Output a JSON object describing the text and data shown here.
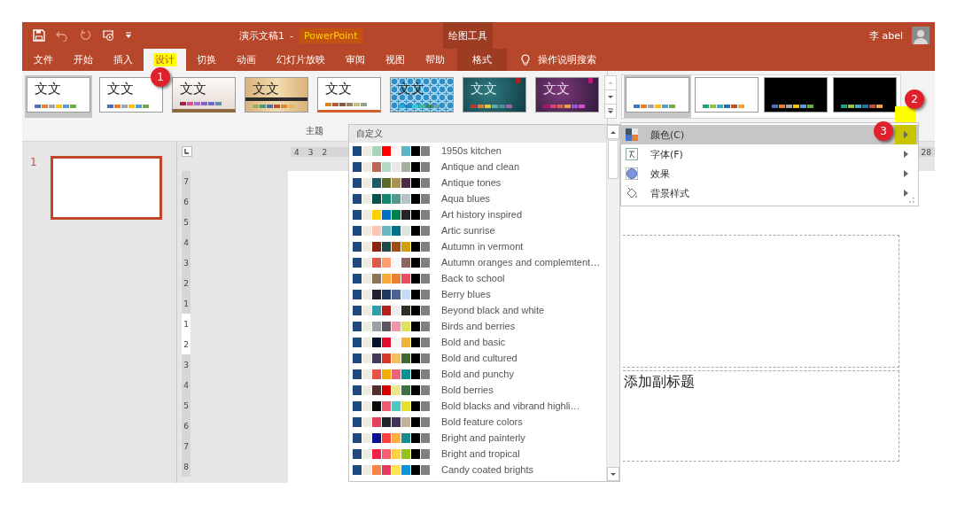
{
  "title_bar": {
    "document_title": "演示文稿1",
    "separator": "-",
    "app_name": "PowerPoint",
    "context_group": "绘图工具",
    "user_name": "李 abel"
  },
  "tabs": [
    {
      "label": "文件",
      "selected": false,
      "highlighted": false,
      "kind": "normal"
    },
    {
      "label": "开始",
      "selected": false,
      "highlighted": false,
      "kind": "normal"
    },
    {
      "label": "插入",
      "selected": false,
      "highlighted": false,
      "kind": "normal"
    },
    {
      "label": "设计",
      "selected": true,
      "highlighted": true,
      "kind": "normal"
    },
    {
      "label": "切换",
      "selected": false,
      "highlighted": false,
      "kind": "normal"
    },
    {
      "label": "动画",
      "selected": false,
      "highlighted": false,
      "kind": "normal"
    },
    {
      "label": "幻灯片放映",
      "selected": false,
      "highlighted": false,
      "kind": "normal"
    },
    {
      "label": "审阅",
      "selected": false,
      "highlighted": false,
      "kind": "normal"
    },
    {
      "label": "视图",
      "selected": false,
      "highlighted": false,
      "kind": "normal"
    },
    {
      "label": "帮助",
      "selected": false,
      "highlighted": false,
      "kind": "normal"
    },
    {
      "label": "格式",
      "selected": false,
      "highlighted": false,
      "kind": "context"
    }
  ],
  "tell_me": "操作说明搜索",
  "themes": {
    "label": "主题",
    "items": [
      {
        "kind": "plain",
        "sample": "文文",
        "selected": true,
        "swatches": [
          {
            "color": "#4472c4"
          },
          {
            "color": "#ed7d31"
          },
          {
            "color": "#a5a5a5"
          },
          {
            "color": "#ffc000"
          },
          {
            "color": "#5b9bd5"
          },
          {
            "color": "#70ad47"
          }
        ]
      },
      {
        "kind": "plain",
        "sample": "文文",
        "selected": false,
        "swatches": [
          {
            "color": "#4472c4"
          },
          {
            "color": "#ed7d31"
          },
          {
            "color": "#a5a5a5"
          },
          {
            "color": "#ffc000"
          },
          {
            "color": "#5b9bd5"
          },
          {
            "color": "#70ad47"
          }
        ]
      },
      {
        "kind": "paper",
        "sample": "文文",
        "selected": false,
        "swatches": [
          {
            "color": "#a5214e"
          },
          {
            "color": "#e44e8a"
          },
          {
            "color": "#b066e0"
          },
          {
            "color": "#8a5fd0"
          },
          {
            "color": "#6a6ae0"
          },
          {
            "color": "#5b8ea8"
          }
        ]
      },
      {
        "kind": "wood",
        "sample": "文文",
        "selected": false,
        "swatches": [
          {
            "color": "#94b264"
          },
          {
            "color": "#3d9e8c"
          },
          {
            "color": "#4a72ad"
          },
          {
            "color": "#c04f3a"
          },
          {
            "color": "#e08a30"
          },
          {
            "color": "#e8b84a"
          }
        ]
      },
      {
        "kind": "rule",
        "sample": "文文",
        "selected": false,
        "swatches": [
          {
            "color": "#e48312"
          },
          {
            "color": "#bd582c"
          },
          {
            "color": "#865640"
          },
          {
            "color": "#9b8357"
          },
          {
            "color": "#c2bc80"
          },
          {
            "color": "#94a088"
          }
        ]
      },
      {
        "kind": "pattern",
        "sample": "文文",
        "selected": false,
        "swatches": [
          {
            "color": "#1cade4"
          },
          {
            "color": "#2683c6"
          },
          {
            "color": "#27ced7"
          },
          {
            "color": "#42ba97"
          },
          {
            "color": "#3e8853"
          },
          {
            "color": "#62a39f"
          }
        ]
      },
      {
        "kind": "teal",
        "sample": "文文",
        "selected": false,
        "swatches": [
          {
            "color": "#c0392b"
          },
          {
            "color": "#e87a2a"
          },
          {
            "color": "#f2c12e"
          },
          {
            "color": "#5bb38f"
          },
          {
            "color": "#4e8aa8"
          },
          {
            "color": "#a85fa8"
          }
        ]
      },
      {
        "kind": "purple",
        "sample": "文文",
        "selected": false,
        "swatches": [
          {
            "color": "#b31166"
          },
          {
            "color": "#e33d6f"
          },
          {
            "color": "#e45f3c"
          },
          {
            "color": "#e9a23b"
          },
          {
            "color": "#9b57d3"
          },
          {
            "color": "#d24fd4"
          }
        ]
      }
    ]
  },
  "variants": [
    {
      "kind": "light",
      "selected": true,
      "swatches": [
        {
          "color": "#4472c4"
        },
        {
          "color": "#ed7d31"
        },
        {
          "color": "#a5a5a5"
        },
        {
          "color": "#ffc000"
        },
        {
          "color": "#5b9bd5"
        },
        {
          "color": "#70ad47"
        }
      ]
    },
    {
      "kind": "light",
      "selected": false,
      "swatches": [
        {
          "color": "#1fa186"
        },
        {
          "color": "#8cc43f"
        },
        {
          "color": "#37aec9"
        },
        {
          "color": "#2271ae"
        },
        {
          "color": "#c2502d"
        },
        {
          "color": "#f4a02a"
        }
      ]
    },
    {
      "kind": "dark",
      "selected": false,
      "swatches": [
        {
          "color": "#4472c4"
        },
        {
          "color": "#ed7d31"
        },
        {
          "color": "#a5a5a5"
        },
        {
          "color": "#ffc000"
        },
        {
          "color": "#5b9bd5"
        },
        {
          "color": "#70ad47"
        }
      ]
    },
    {
      "kind": "dark",
      "selected": false,
      "swatches": [
        {
          "color": "#1fa186"
        },
        {
          "color": "#8cc43f"
        },
        {
          "color": "#37aec9"
        },
        {
          "color": "#2271ae"
        },
        {
          "color": "#c2502d"
        },
        {
          "color": "#f4a02a"
        }
      ]
    }
  ],
  "color_schemes": {
    "header": "自定义",
    "items": [
      {
        "name": "1950s kitchen",
        "swatches": [
          {
            "color": "#1f497d"
          },
          {
            "color": "#eeece1"
          },
          {
            "color": "#a8d5b8"
          },
          {
            "color": "#ff0000"
          },
          {
            "color": "#fdf5f5"
          },
          {
            "color": "#5bb5c9"
          },
          {
            "color": "#000000"
          },
          {
            "color": "#808080"
          }
        ]
      },
      {
        "name": "Antique and clean",
        "swatches": [
          {
            "color": "#1f497d"
          },
          {
            "color": "#eeece1"
          },
          {
            "color": "#b86655"
          },
          {
            "color": "#b3dbc0"
          },
          {
            "color": "#ece6ec"
          },
          {
            "color": "#a3b09e"
          },
          {
            "color": "#000000"
          },
          {
            "color": "#808080"
          }
        ]
      },
      {
        "name": "Antique tones",
        "swatches": [
          {
            "color": "#1f497d"
          },
          {
            "color": "#eeece1"
          },
          {
            "color": "#1c5c65"
          },
          {
            "color": "#5a6a2a"
          },
          {
            "color": "#aa9350"
          },
          {
            "color": "#4e2c3f"
          },
          {
            "color": "#000000"
          },
          {
            "color": "#808080"
          }
        ]
      },
      {
        "name": "Aqua blues",
        "swatches": [
          {
            "color": "#1f497d"
          },
          {
            "color": "#eeece1"
          },
          {
            "color": "#06524a"
          },
          {
            "color": "#168572"
          },
          {
            "color": "#549a8c"
          },
          {
            "color": "#b4c3c6"
          },
          {
            "color": "#000000"
          },
          {
            "color": "#808080"
          }
        ]
      },
      {
        "name": "Art history inspired",
        "swatches": [
          {
            "color": "#1f497d"
          },
          {
            "color": "#eeece1"
          },
          {
            "color": "#ffd000"
          },
          {
            "color": "#0070c0"
          },
          {
            "color": "#008050"
          },
          {
            "color": "#252228"
          },
          {
            "color": "#000000"
          },
          {
            "color": "#808080"
          }
        ]
      },
      {
        "name": "Artic sunrise",
        "swatches": [
          {
            "color": "#1f497d"
          },
          {
            "color": "#eeece1"
          },
          {
            "color": "#ffc4b4"
          },
          {
            "color": "#6ab5c2"
          },
          {
            "color": "#036f88"
          },
          {
            "color": "#dde5e0"
          },
          {
            "color": "#000000"
          },
          {
            "color": "#808080"
          }
        ]
      },
      {
        "name": "Autumn in vermont",
        "swatches": [
          {
            "color": "#1f497d"
          },
          {
            "color": "#eeece1"
          },
          {
            "color": "#8b2510"
          },
          {
            "color": "#1f4a4b"
          },
          {
            "color": "#9c4f0e"
          },
          {
            "color": "#cf9e0d"
          },
          {
            "color": "#000000"
          },
          {
            "color": "#808080"
          }
        ]
      },
      {
        "name": "Autumn oranges and complemtent…",
        "swatches": [
          {
            "color": "#1f497d"
          },
          {
            "color": "#eeece1"
          },
          {
            "color": "#dc5a48"
          },
          {
            "color": "#ff9e74"
          },
          {
            "color": "#f6f8fc"
          },
          {
            "color": "#8e6660"
          },
          {
            "color": "#000000"
          },
          {
            "color": "#808080"
          }
        ]
      },
      {
        "name": "Back to school",
        "swatches": [
          {
            "color": "#1f497d"
          },
          {
            "color": "#eeece1"
          },
          {
            "color": "#8c7458"
          },
          {
            "color": "#f8ab3a"
          },
          {
            "color": "#e8822e"
          },
          {
            "color": "#e5505f"
          },
          {
            "color": "#000000"
          },
          {
            "color": "#808080"
          }
        ]
      },
      {
        "name": "Berry blues",
        "swatches": [
          {
            "color": "#1f497d"
          },
          {
            "color": "#eeece1"
          },
          {
            "color": "#1f2032"
          },
          {
            "color": "#24385f"
          },
          {
            "color": "#4b6290"
          },
          {
            "color": "#c8dbf5"
          },
          {
            "color": "#000000"
          },
          {
            "color": "#808080"
          }
        ]
      },
      {
        "name": "Beyond black and white",
        "swatches": [
          {
            "color": "#1f497d"
          },
          {
            "color": "#eeece1"
          },
          {
            "color": "#30a0a8"
          },
          {
            "color": "#b3201e"
          },
          {
            "color": "#ededed"
          },
          {
            "color": "#2f2f28"
          },
          {
            "color": "#000000"
          },
          {
            "color": "#808080"
          }
        ]
      },
      {
        "name": "Birds and berries",
        "swatches": [
          {
            "color": "#1f497d"
          },
          {
            "color": "#eeece1"
          },
          {
            "color": "#9aa0a8"
          },
          {
            "color": "#5e5563"
          },
          {
            "color": "#ee96a5"
          },
          {
            "color": "#e2e060"
          },
          {
            "color": "#000000"
          },
          {
            "color": "#808080"
          }
        ]
      },
      {
        "name": "Bold and basic",
        "swatches": [
          {
            "color": "#1f497d"
          },
          {
            "color": "#eeece1"
          },
          {
            "color": "#07122e"
          },
          {
            "color": "#df0d2e"
          },
          {
            "color": "#f8f5f0"
          },
          {
            "color": "#f0b43c"
          },
          {
            "color": "#000000"
          },
          {
            "color": "#808080"
          }
        ]
      },
      {
        "name": "Bold and cultured",
        "swatches": [
          {
            "color": "#1f497d"
          },
          {
            "color": "#eeece1"
          },
          {
            "color": "#45385b"
          },
          {
            "color": "#d33a2c"
          },
          {
            "color": "#f2bf5a"
          },
          {
            "color": "#44662e"
          },
          {
            "color": "#000000"
          },
          {
            "color": "#808080"
          }
        ]
      },
      {
        "name": "Bold and punchy",
        "swatches": [
          {
            "color": "#1f497d"
          },
          {
            "color": "#eeece1"
          },
          {
            "color": "#e65045"
          },
          {
            "color": "#f0ae00"
          },
          {
            "color": "#eb6378"
          },
          {
            "color": "#0b9090"
          },
          {
            "color": "#000000"
          },
          {
            "color": "#808080"
          }
        ]
      },
      {
        "name": "Bold berries",
        "swatches": [
          {
            "color": "#1f497d"
          },
          {
            "color": "#eeece1"
          },
          {
            "color": "#522e2e"
          },
          {
            "color": "#d40000"
          },
          {
            "color": "#e8e88a"
          },
          {
            "color": "#3e6f48"
          },
          {
            "color": "#000000"
          },
          {
            "color": "#808080"
          }
        ]
      },
      {
        "name": "Bold blacks and vibrand highli…",
        "swatches": [
          {
            "color": "#1f497d"
          },
          {
            "color": "#eeece1"
          },
          {
            "color": "#0a0a0a"
          },
          {
            "color": "#f05a6e"
          },
          {
            "color": "#4ec8c0"
          },
          {
            "color": "#e6e030"
          },
          {
            "color": "#000000"
          },
          {
            "color": "#808080"
          }
        ]
      },
      {
        "name": "Bold feature colors",
        "swatches": [
          {
            "color": "#1f497d"
          },
          {
            "color": "#eeece1"
          },
          {
            "color": "#e6405c"
          },
          {
            "color": "#20232a"
          },
          {
            "color": "#3f3456"
          },
          {
            "color": "#c2b09a"
          },
          {
            "color": "#000000"
          },
          {
            "color": "#808080"
          }
        ]
      },
      {
        "name": "Bright and painterly",
        "swatches": [
          {
            "color": "#1f497d"
          },
          {
            "color": "#eeece1"
          },
          {
            "color": "#0a0f8c"
          },
          {
            "color": "#ff4040"
          },
          {
            "color": "#ffb040"
          },
          {
            "color": "#1a8c8c"
          },
          {
            "color": "#000000"
          },
          {
            "color": "#808080"
          }
        ]
      },
      {
        "name": "Bright and tropical",
        "swatches": [
          {
            "color": "#1f497d"
          },
          {
            "color": "#eeece1"
          },
          {
            "color": "#f52047"
          },
          {
            "color": "#f56070"
          },
          {
            "color": "#ffd040"
          },
          {
            "color": "#96c01e"
          },
          {
            "color": "#000000"
          },
          {
            "color": "#808080"
          }
        ]
      },
      {
        "name": "Candy coated brights",
        "swatches": [
          {
            "color": "#1f497d"
          },
          {
            "color": "#eeece1"
          },
          {
            "color": "#f8824a"
          },
          {
            "color": "#e43a63"
          },
          {
            "color": "#ffe550"
          },
          {
            "color": "#0a96d8"
          },
          {
            "color": "#000000"
          },
          {
            "color": "#808080"
          }
        ]
      }
    ]
  },
  "variant_menu": [
    {
      "label": "颜色(C)",
      "kind": "colors",
      "selected": true,
      "highlighted": true
    },
    {
      "label": "字体(F)",
      "kind": "fonts",
      "selected": false,
      "highlighted": false
    },
    {
      "label": "效果",
      "kind": "effects",
      "selected": false,
      "highlighted": false
    },
    {
      "label": "背景样式",
      "kind": "background",
      "selected": false,
      "highlighted": false
    }
  ],
  "slides": [
    {
      "number": "1",
      "selected": true
    }
  ],
  "rulers": {
    "horizontal": [
      "4",
      "3",
      "2"
    ],
    "horizontal_end": "28",
    "vertical": [
      "7",
      "6",
      "5",
      "4",
      "3",
      "2",
      "1",
      "1",
      "2",
      "3",
      "4",
      "5",
      "6",
      "7",
      "8"
    ]
  },
  "slide": {
    "subtitle_placeholder": "添加副标题"
  },
  "annotations": [
    {
      "label": "1"
    },
    {
      "label": "2"
    },
    {
      "label": "3"
    }
  ]
}
